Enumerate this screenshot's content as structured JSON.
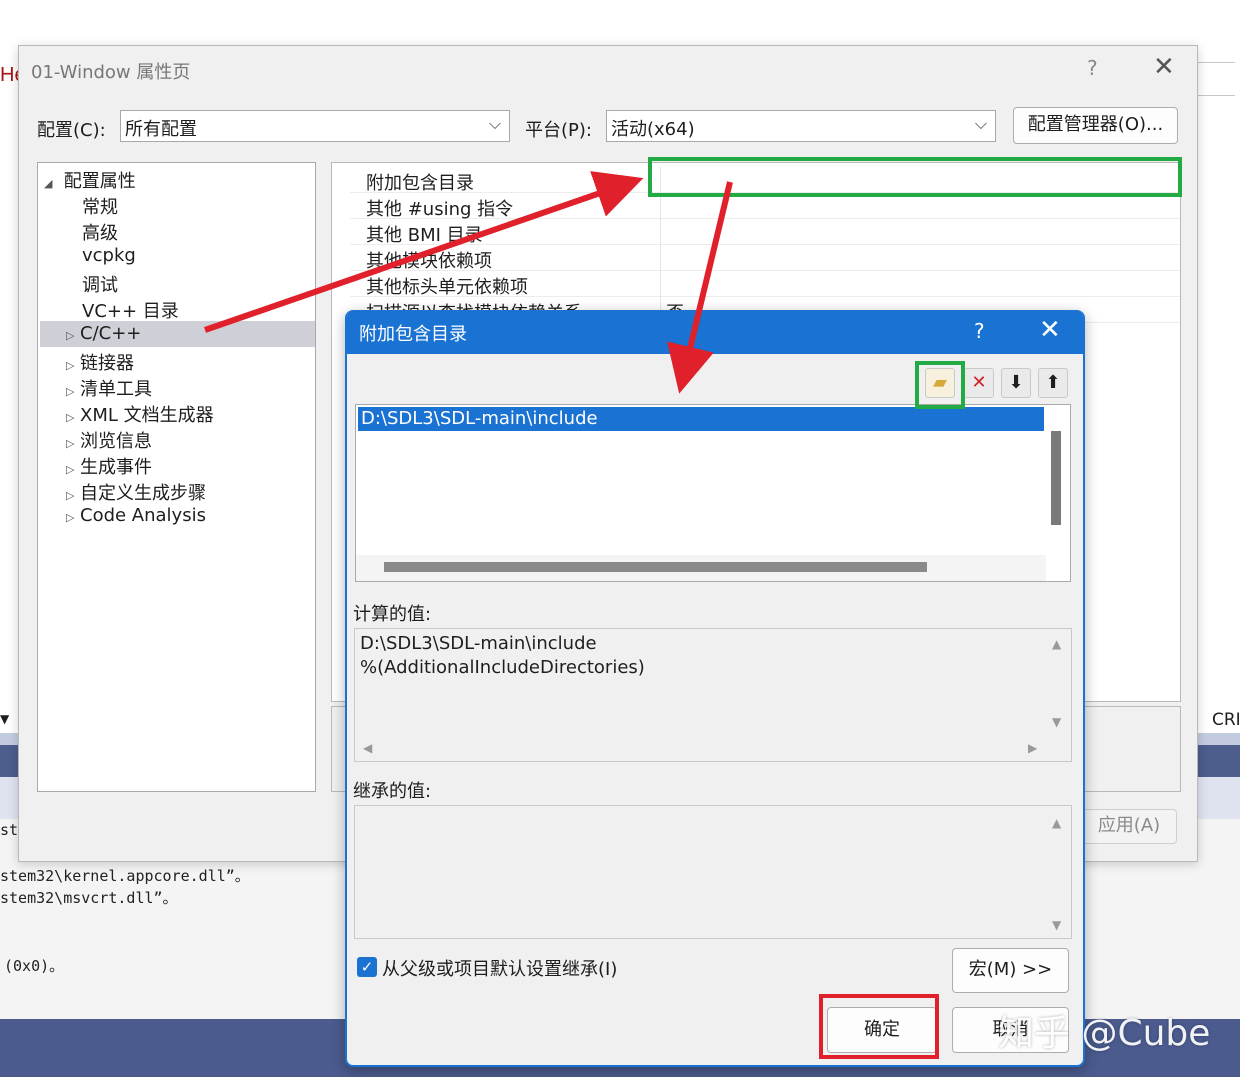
{
  "background": {
    "partial_red_text": "He",
    "console_lines": [
      "stem32\\kernel.appcore.dll”。",
      "stem32\\msvcrt.dll”。",
      "(0x0)。"
    ],
    "partial_ste": "ste",
    "partial_cri": "CRI",
    "triangle": "▼"
  },
  "main_dialog": {
    "title": "01-Window 属性页",
    "help": "?",
    "close": "✕",
    "config_label": "配置(C):",
    "config_value": "所有配置",
    "platform_label": "平台(P):",
    "platform_value": "活动(x64)",
    "config_manager_button": "配置管理器(O)...",
    "apply_button": "应用(A)",
    "tree": {
      "root": "配置属性",
      "children": [
        "常规",
        "高级",
        "vcpkg",
        "调试",
        "VC++ 目录"
      ],
      "expandable": [
        "C/C++",
        "链接器",
        "清单工具",
        "XML 文档生成器",
        "浏览信息",
        "生成事件",
        "自定义生成步骤",
        "Code Analysis"
      ]
    },
    "properties": [
      {
        "name": "附加包含目录",
        "value": ""
      },
      {
        "name": "其他 #using 指令",
        "value": ""
      },
      {
        "name": "其他 BMI 目录",
        "value": ""
      },
      {
        "name": "其他模块依赖项",
        "value": ""
      },
      {
        "name": "其他标头单元依赖项",
        "value": ""
      },
      {
        "name": "扫描源以查找模块依赖关系",
        "value": "否"
      }
    ]
  },
  "child_dialog": {
    "title": "附加包含目录",
    "help": "?",
    "close": "✕",
    "toolbar": {
      "new_line_icon": "folder-new-icon",
      "delete_icon": "delete-icon",
      "move_down_icon": "move-down-icon",
      "move_up_icon": "move-up-icon"
    },
    "list_items": [
      "D:\\SDL3\\SDL-main\\include"
    ],
    "evaluated_label": "计算的值:",
    "evaluated_lines": [
      "D:\\SDL3\\SDL-main\\include",
      "%(AdditionalIncludeDirectories)"
    ],
    "inherited_label": "继承的值:",
    "inherit_checkbox_label": "从父级或项目默认设置继承(I)",
    "inherit_checked": true,
    "macros_button": "宏(M) >>",
    "ok_button": "确定",
    "cancel_button": "取消"
  },
  "watermark": "知乎 @Cube",
  "colors": {
    "accent": "#1a73d2",
    "highlight_green": "#22aa44",
    "highlight_red": "#e0202a"
  }
}
